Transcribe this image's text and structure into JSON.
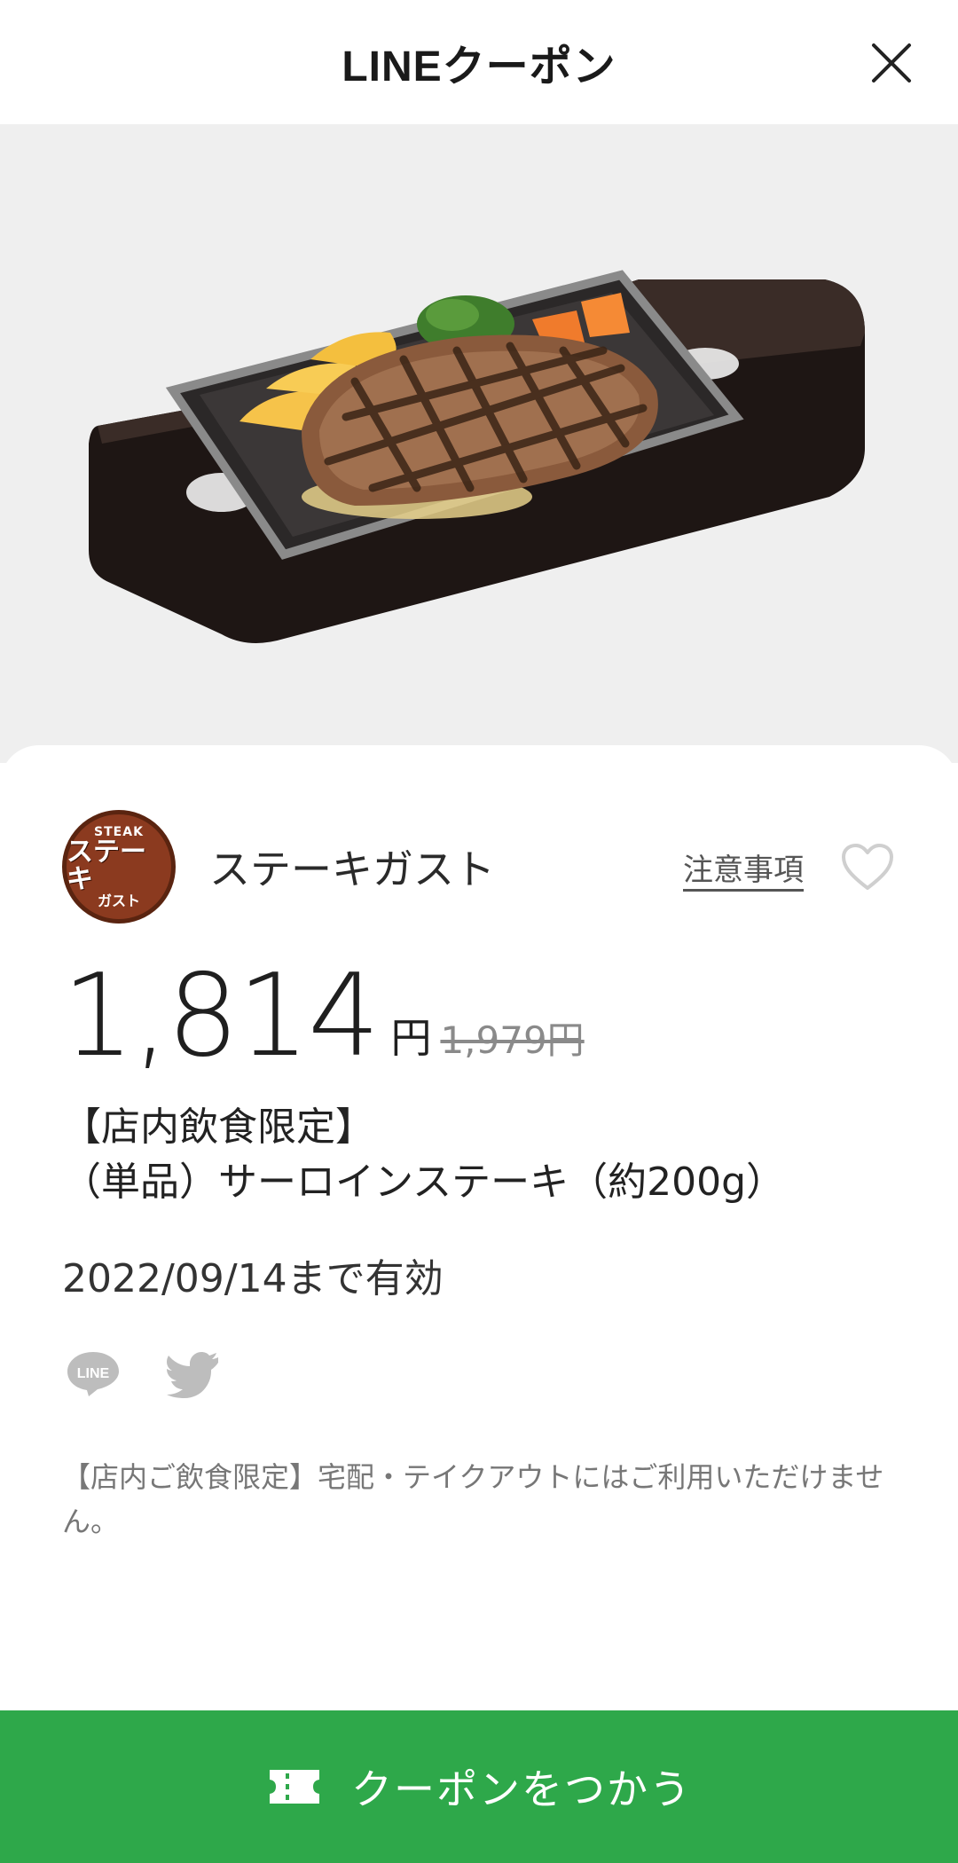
{
  "header": {
    "title": "LINEクーポン"
  },
  "store": {
    "name": "ステーキガスト",
    "logo": {
      "top": "STEAK",
      "main": "ステーキ",
      "sub": "ガスト"
    },
    "notice_label": "注意事項"
  },
  "offer": {
    "price": "1,814",
    "unit": "円",
    "original_price": "1,979円",
    "title_line1": "【店内飲食限定】",
    "title_line2": "（単品）サーロインステーキ（約200g）",
    "validity": "2022/09/14まで有効",
    "description": "【店内ご飲食限定】宅配・テイクアウトにはご利用いただけません。"
  },
  "share": {
    "line_label": "LINE"
  },
  "action": {
    "use_label": "クーポンをつかう"
  },
  "colors": {
    "accent_green": "#2ea84a",
    "hero_bg": "#efefef"
  }
}
